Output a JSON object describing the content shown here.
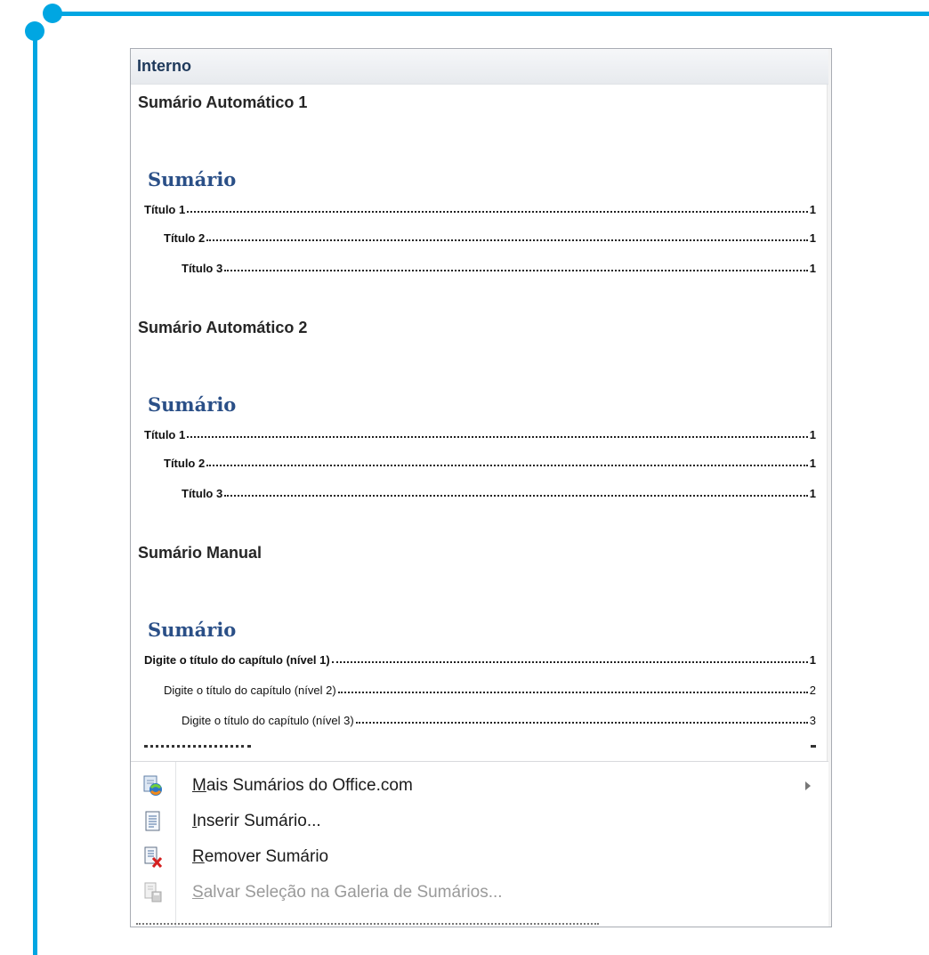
{
  "gallery": {
    "section_header": "Interno",
    "items": [
      {
        "title": "Sumário Automático 1",
        "toc_heading": "Sumário",
        "entries": [
          {
            "label": "Título 1",
            "page": "1"
          },
          {
            "label": "Título 2",
            "page": "1"
          },
          {
            "label": "Título 3",
            "page": "1"
          }
        ]
      },
      {
        "title": "Sumário Automático 2",
        "toc_heading": "Sumário",
        "entries": [
          {
            "label": "Título 1",
            "page": "1"
          },
          {
            "label": "Título 2",
            "page": "1"
          },
          {
            "label": "Título 3",
            "page": "1"
          }
        ]
      },
      {
        "title": "Sumário Manual",
        "toc_heading": "Sumário",
        "entries": [
          {
            "label": "Digite o título do capítulo (nível 1)",
            "page": "1"
          },
          {
            "label": "Digite o título do capítulo (nível 2)",
            "page": "2"
          },
          {
            "label": "Digite o título do capítulo (nível 3)",
            "page": "3"
          }
        ]
      }
    ]
  },
  "menu": {
    "more_office": {
      "accel": "M",
      "rest": "ais Sumários do Office.com",
      "icon": "office-globe-icon"
    },
    "insert": {
      "accel": "I",
      "rest": "nserir Sumário...",
      "icon": "document-icon"
    },
    "remove": {
      "accel": "R",
      "rest": "emover Sumário",
      "icon": "remove-document-icon"
    },
    "save_selection": {
      "accel": "S",
      "rest": "alvar Seleção na Galeria de Sumários...",
      "icon": "save-gallery-icon",
      "disabled": true
    }
  },
  "colors": {
    "frame": "#00a6e2",
    "toc_heading": "#2a4f87",
    "section_header_text": "#1e395b"
  }
}
